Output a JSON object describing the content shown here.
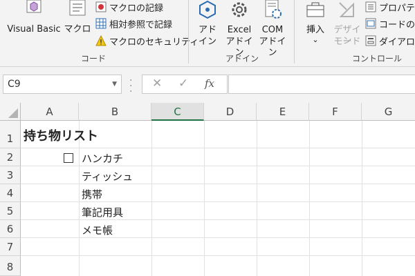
{
  "ribbon": {
    "code_group": {
      "label": "コード",
      "visual_basic": "Visual Basic",
      "macro": "マクロ",
      "record_macro": "マクロの記録",
      "relative_reference": "相対参照で記録",
      "macro_security": "マクロのセキュリティ"
    },
    "addin_group": {
      "label": "アドイン",
      "addin_line1": "アド",
      "addin_line2": "イン",
      "excel_addin_line1": "Excel",
      "excel_addin_line2": "アドイン",
      "com_addin_line1": "COM",
      "com_addin_line2": "アドイン"
    },
    "control_group": {
      "label": "コントロール",
      "insert": "挿入",
      "insert_arrow": "⌄",
      "design_mode_line1": "デザイン",
      "design_mode_line2": "モード",
      "properties": "プロパティ",
      "view_code": "コードの表",
      "dialog": "ダイアログ"
    }
  },
  "formula_bar": {
    "name_box": "C9",
    "cancel": "✕",
    "enter": "✓",
    "fx": "fx",
    "formula": ""
  },
  "sheet": {
    "columns": [
      "A",
      "B",
      "C",
      "D",
      "E",
      "F",
      "G"
    ],
    "selected_column": "C",
    "rows": [
      "1",
      "2",
      "3",
      "4",
      "5",
      "6",
      "7",
      "8"
    ],
    "cells": {
      "A1": "持ち物リスト",
      "B2": "ハンカチ",
      "B3": "ティッシュ",
      "B4": "携帯",
      "B5": "筆記用具",
      "B6": "メモ帳"
    }
  },
  "colors": {
    "excel_green": "#217346",
    "ribbon_bg": "#f3f3f3",
    "addin_blue": "#2b6cb0"
  }
}
